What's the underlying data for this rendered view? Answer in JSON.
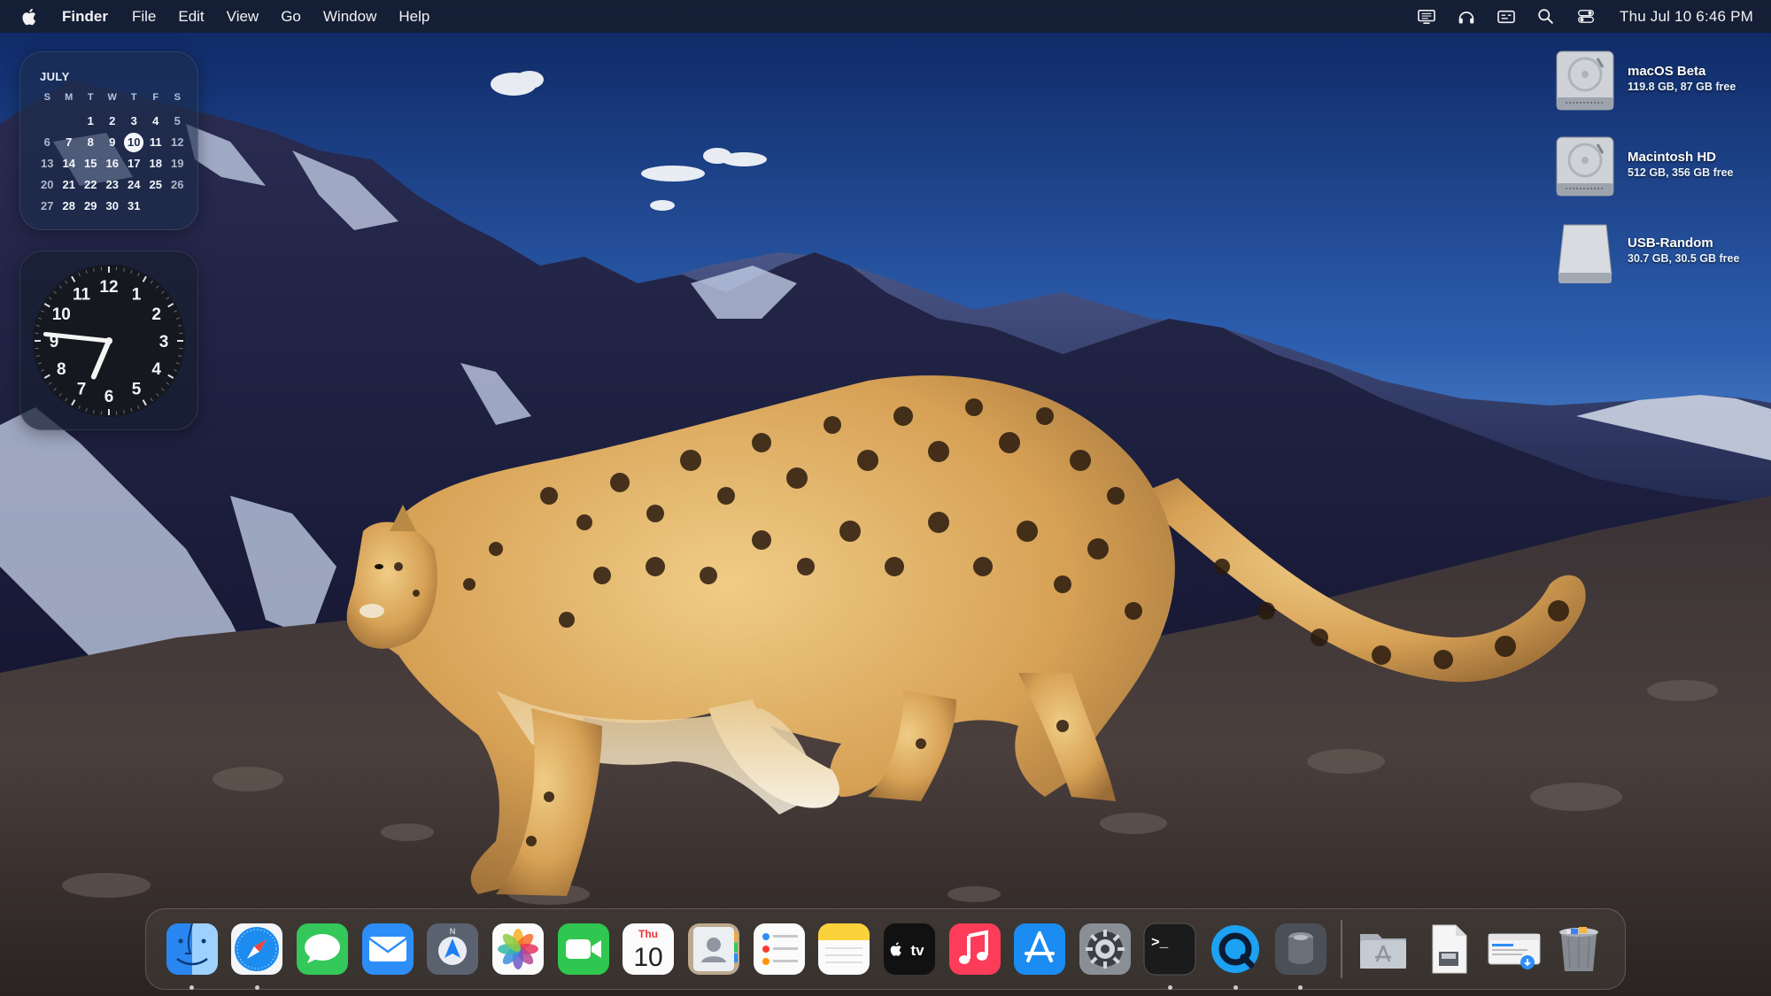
{
  "menubar": {
    "app_name": "Finder",
    "menus": [
      "File",
      "Edit",
      "View",
      "Go",
      "Window",
      "Help"
    ],
    "status_icons": [
      "display-icon",
      "headphones-icon",
      "caption-icon",
      "search-icon",
      "control-center-icon"
    ],
    "clock": "Thu Jul 10  6:46 PM"
  },
  "calendar_widget": {
    "month": "JULY",
    "weekdays": [
      "S",
      "M",
      "T",
      "W",
      "T",
      "F",
      "S"
    ],
    "weeks": [
      [
        "",
        "",
        "1",
        "2",
        "3",
        "4",
        "5"
      ],
      [
        "6",
        "7",
        "8",
        "9",
        "10",
        "11",
        "12"
      ],
      [
        "13",
        "14",
        "15",
        "16",
        "17",
        "18",
        "19"
      ],
      [
        "20",
        "21",
        "22",
        "23",
        "24",
        "25",
        "26"
      ],
      [
        "27",
        "28",
        "29",
        "30",
        "31",
        "",
        ""
      ]
    ],
    "today": "10"
  },
  "clock_widget": {
    "numbers": [
      "12",
      "1",
      "2",
      "3",
      "4",
      "5",
      "6",
      "7",
      "8",
      "9",
      "10",
      "11"
    ],
    "time": "6:46"
  },
  "drives": [
    {
      "name": "macOS Beta",
      "info": "119.8 GB, 87 GB free",
      "icon": "hard-drive-icon"
    },
    {
      "name": "Macintosh HD",
      "info": "512 GB, 356 GB free",
      "icon": "hard-drive-icon"
    },
    {
      "name": "USB-Random",
      "info": "30.7 GB, 30.5 GB free",
      "icon": "external-drive-icon"
    }
  ],
  "dock": {
    "apps": [
      "Finder",
      "Safari",
      "Messages",
      "Mail",
      "Maps",
      "Photos",
      "FaceTime",
      "Calendar",
      "Contacts",
      "Reminders",
      "Notes",
      "TV",
      "Music",
      "App Store",
      "System Settings",
      "Terminal",
      "QuickTime Player",
      "Disk Utility"
    ],
    "calendar_tile": {
      "day": "Thu",
      "date": "10"
    },
    "tv_label": "tv",
    "terminal_prompt": ">_",
    "stacks": [
      "Applications",
      "Documents",
      "Downloads",
      "Trash"
    ],
    "running": [
      "Finder",
      "Safari",
      "Terminal",
      "QuickTime Player",
      "Disk Utility"
    ]
  },
  "colors": {
    "sky_top": "#0e2a66",
    "sky_bottom": "#7fb0e6",
    "menubar": "#1b1f27",
    "leopard_fur": "#d9a95a"
  }
}
